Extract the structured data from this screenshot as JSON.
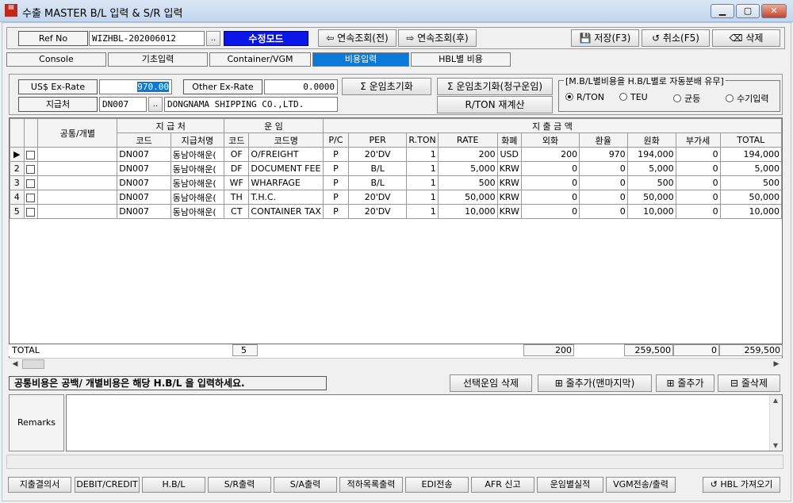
{
  "window": {
    "title": "수출 MASTER B/L 입력 & S/R 입력",
    "icon": "app-icon",
    "min": "▁",
    "max": "▢",
    "close": "✕"
  },
  "toolbar": {
    "ref_label": "Ref No",
    "ref_value": "WIZHBL-202006012",
    "ref_lookup": "..",
    "mode": "수정모드",
    "prev": "⇦ 연속조회(전)",
    "next": "⇨ 연속조회(후)",
    "save": "💾 저장(F3)",
    "cancel": "↺ 취소(F5)",
    "delete": "⌫ 삭제"
  },
  "tabs": [
    "Console",
    "기초입력",
    "Container/VGM",
    "비용입력",
    "HBL별 비용"
  ],
  "active_tab": 3,
  "form": {
    "usd_label": "US$ Ex-Rate",
    "usd_value": "970.00",
    "other_label": "Other Ex-Rate",
    "other_value": "0.0000",
    "payee_label": "지급처",
    "payee_code": "DN007",
    "payee_lookup": "..",
    "payee_name": "DONGNAMA SHIPPING CO.,LTD.",
    "btn_freight_init": "Σ 운임초기화",
    "btn_freight_init_bill": "Σ 운임초기화(청구운임)",
    "btn_rton": "R/TON 재계산",
    "dist_title": "[M.B/L별비용을 H.B/L별로 자동분배 유무]",
    "dist_options": [
      "R/TON",
      "TEU",
      "균등",
      "수기입력"
    ],
    "dist_selected": 0
  },
  "grid": {
    "group_headers": {
      "share": "공통/개별",
      "payee": "지 급 처",
      "freight": "운 임",
      "amount": "지 출 금 액"
    },
    "columns": [
      "코드",
      "지급처명",
      "코드",
      "코드명",
      "P/C",
      "PER",
      "R.TON",
      "RATE",
      "화폐",
      "외화",
      "환율",
      "원화",
      "부가세",
      "TOTAL"
    ],
    "rows": [
      {
        "no": "▶",
        "payee_code": "DN007",
        "payee_name": "동남아해운(",
        "code": "OF",
        "name": "O/FREIGHT",
        "pc": "P",
        "per": "20'DV",
        "rton": "1",
        "rate": "200",
        "cur": "USD",
        "fx": "200",
        "ex": "970",
        "krw": "194,000",
        "vat": "0",
        "total": "194,000"
      },
      {
        "no": "2",
        "payee_code": "DN007",
        "payee_name": "동남아해운(",
        "code": "DF",
        "name": "DOCUMENT FEE",
        "pc": "P",
        "per": "B/L",
        "rton": "1",
        "rate": "5,000",
        "cur": "KRW",
        "fx": "0",
        "ex": "0",
        "krw": "5,000",
        "vat": "0",
        "total": "5,000"
      },
      {
        "no": "3",
        "payee_code": "DN007",
        "payee_name": "동남아해운(",
        "code": "WF",
        "name": "WHARFAGE",
        "pc": "P",
        "per": "B/L",
        "rton": "1",
        "rate": "500",
        "cur": "KRW",
        "fx": "0",
        "ex": "0",
        "krw": "500",
        "vat": "0",
        "total": "500"
      },
      {
        "no": "4",
        "payee_code": "DN007",
        "payee_name": "동남아해운(",
        "code": "TH",
        "name": "T.H.C.",
        "pc": "P",
        "per": "20'DV",
        "rton": "1",
        "rate": "50,000",
        "cur": "KRW",
        "fx": "0",
        "ex": "0",
        "krw": "50,000",
        "vat": "0",
        "total": "50,000"
      },
      {
        "no": "5",
        "payee_code": "DN007",
        "payee_name": "동남아해운(",
        "code": "CT",
        "name": "CONTAINER TAX",
        "pc": "P",
        "per": "20'DV",
        "rton": "1",
        "rate": "10,000",
        "cur": "KRW",
        "fx": "0",
        "ex": "0",
        "krw": "10,000",
        "vat": "0",
        "total": "10,000"
      }
    ],
    "totals": {
      "label": "TOTAL",
      "count": "5",
      "fx": "200",
      "krw": "259,500",
      "vat": "0",
      "total": "259,500"
    },
    "scroll_left": "◀",
    "scroll_right": "▶"
  },
  "notice": "공통비용은 공백/ 개별비용은 해당 H.B/L 을 입력하세요.",
  "row_actions": {
    "delete_selected": "선택운임 삭제",
    "add_last": "⊞ 줄추가(맨마지막)",
    "add": "⊞ 줄추가",
    "remove": "⊟ 줄삭제"
  },
  "remarks": {
    "label": "Remarks",
    "value": "",
    "up": "▲",
    "down": "▼"
  },
  "bottom_buttons": [
    "지출결의서",
    "DEBIT/CREDIT",
    "H.B/L",
    "S/R출력",
    "S/A출력",
    "적하목록출력",
    "EDI전송",
    "AFR 신고",
    "운임별실적",
    "VGM전송/출력",
    "↺ HBL 가져오기"
  ]
}
